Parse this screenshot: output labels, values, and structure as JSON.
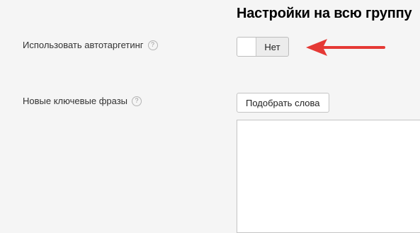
{
  "header": {
    "title": "Настройки на всю группу"
  },
  "autotargeting": {
    "label": "Использовать автотаргетинг",
    "help_icon": "?",
    "toggle_value": "Нет",
    "toggle_on": false
  },
  "keywords": {
    "label": "Новые ключевые фразы",
    "help_icon": "?",
    "pick_button_label": "Подобрать слова",
    "textarea_value": ""
  },
  "annotation": {
    "arrow_color": "#e53935",
    "arrow_icon": "arrow-left-icon"
  },
  "colors": {
    "background": "#f5f5f5",
    "accent_arrow": "#e53935"
  }
}
